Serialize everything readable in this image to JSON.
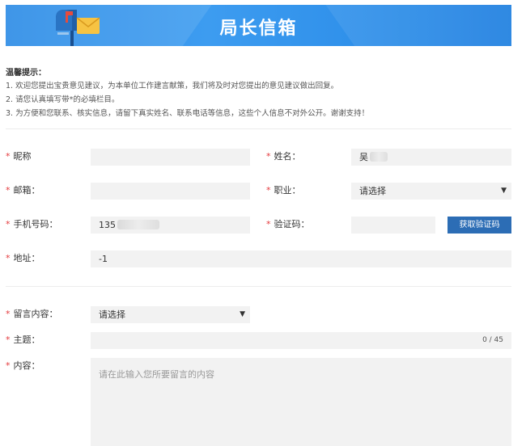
{
  "banner": {
    "title": "局长信箱"
  },
  "tips": {
    "title": "温馨提示：",
    "lines": [
      "1. 欢迎您提出宝贵意见建议，为本单位工作建言献策，我们将及时对您提出的意见建议做出回复。",
      "2. 请您认真填写带*的必填栏目。",
      "3. 为方便和您联系、核实信息，请留下真实姓名、联系电话等信息，这些个人信息不对外公开。谢谢支持！"
    ]
  },
  "form": {
    "required_mark": "*",
    "nickname": {
      "label": "昵称",
      "value": ""
    },
    "name": {
      "label": "姓名：",
      "value": "吴"
    },
    "email": {
      "label": "邮箱：",
      "value": ""
    },
    "occupation": {
      "label": "职业：",
      "value": "请选择",
      "caret": "▼"
    },
    "phone": {
      "label": "手机号码：",
      "value": "135"
    },
    "captcha": {
      "label": "验证码：",
      "value": "",
      "button": "获取验证码"
    },
    "address": {
      "label": "地址：",
      "value": "-1"
    },
    "message_type": {
      "label": "留言内容：",
      "value": "请选择",
      "caret": "▼"
    },
    "subject": {
      "label": "主题：",
      "value": "",
      "counter": "0 / 45"
    },
    "content": {
      "label": "内容：",
      "placeholder": "请在此输入您所要留言的内容"
    }
  },
  "colors": {
    "banner": "#2a8be6",
    "required": "#e4393c",
    "button": "#2c6db5",
    "field_bg": "#f2f2f2"
  }
}
